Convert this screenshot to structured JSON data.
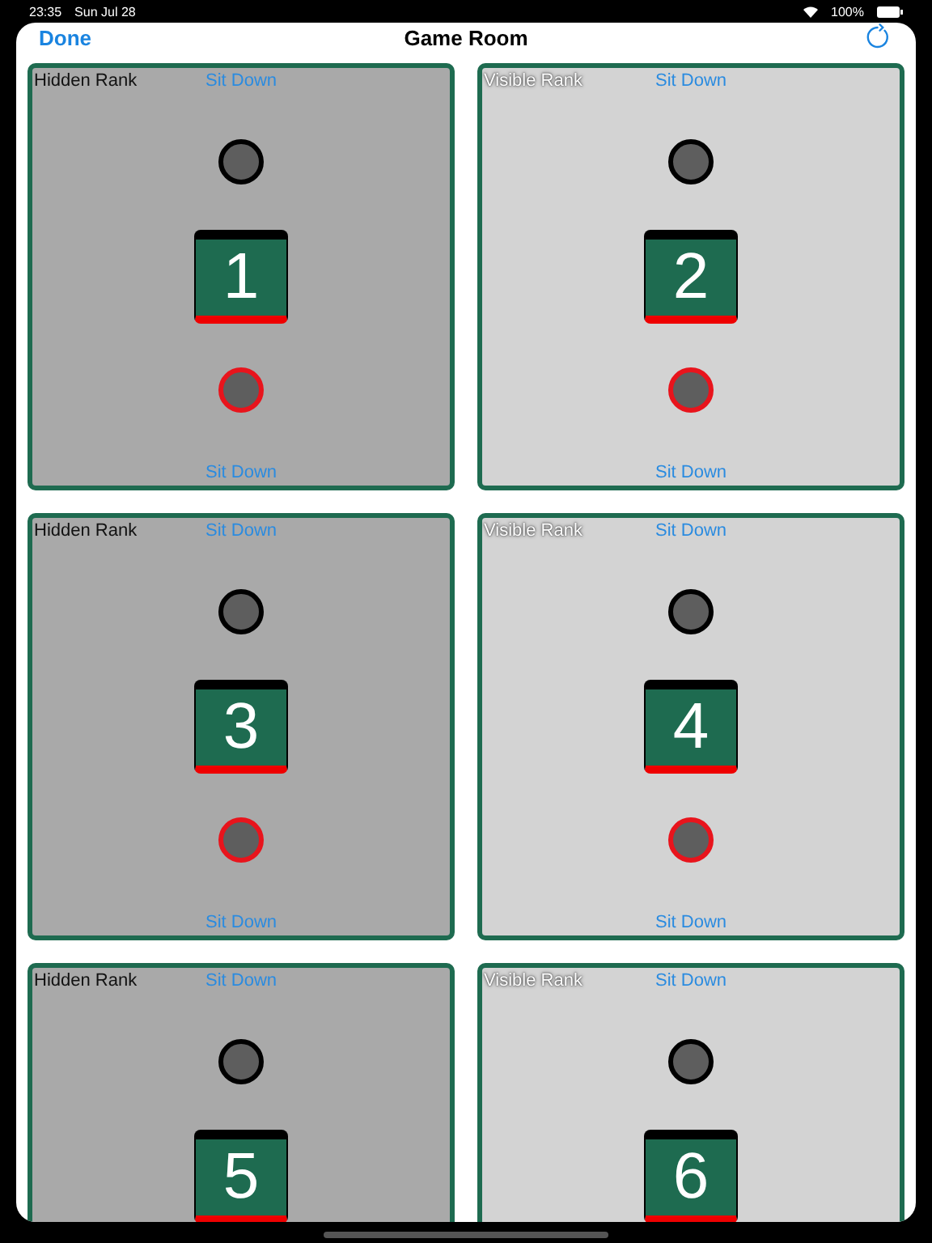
{
  "status_bar": {
    "time": "23:35",
    "date": "Sun Jul 28",
    "battery": "100%"
  },
  "nav": {
    "done": "Done",
    "title": "Game Room"
  },
  "tables": [
    {
      "rank_label": "Hidden Rank",
      "rank_visible": false,
      "top_action": "Sit Down",
      "number": "1",
      "bottom_action": "Sit Down"
    },
    {
      "rank_label": "Visible Rank",
      "rank_visible": true,
      "top_action": "Sit Down",
      "number": "2",
      "bottom_action": "Sit Down"
    },
    {
      "rank_label": "Hidden Rank",
      "rank_visible": false,
      "top_action": "Sit Down",
      "number": "3",
      "bottom_action": "Sit Down"
    },
    {
      "rank_label": "Visible Rank",
      "rank_visible": true,
      "top_action": "Sit Down",
      "number": "4",
      "bottom_action": "Sit Down"
    },
    {
      "rank_label": "Hidden Rank",
      "rank_visible": false,
      "top_action": "Sit Down",
      "number": "5"
    },
    {
      "rank_label": "Visible Rank",
      "rank_visible": true,
      "top_action": "Sit Down",
      "number": "6"
    }
  ]
}
